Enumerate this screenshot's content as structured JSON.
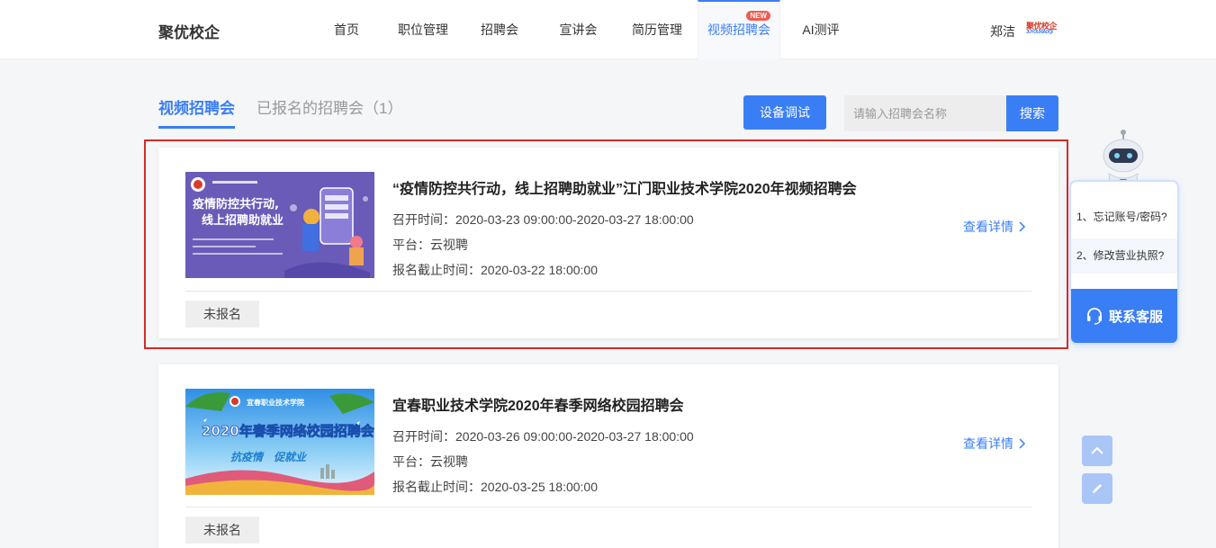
{
  "header": {
    "brand": "聚优校企",
    "nav": [
      {
        "label": "首页"
      },
      {
        "label": "职位管理"
      },
      {
        "label": "招聘会"
      },
      {
        "label": "宣讲会"
      },
      {
        "label": "简历管理"
      },
      {
        "label": "视频招聘会",
        "badge": "NEW",
        "active": true
      },
      {
        "label": "AI测评"
      }
    ],
    "username": "郑洁",
    "logo_text": "聚优校企",
    "logo_sub": "JUYOUXIAOQI"
  },
  "tabs": {
    "video_fairs": "视频招聘会",
    "registered": "已报名的招聘会（1）"
  },
  "toolbar": {
    "device_test": "设备调试",
    "search_placeholder": "请输入招聘会名称",
    "search_label": "搜索"
  },
  "fairs": [
    {
      "title": "“疫情防控共行动，线上招聘助就业”江门职业技术学院2020年视频招聘会",
      "start_time": "召开时间：2020-03-23 09:00:00-2020-03-27 18:00:00",
      "platform": "平台：云视聘",
      "deadline": "报名截止时间：2020-03-22 18:00:00",
      "details": "查看详情",
      "status": "未报名",
      "poster_line1": "疫情防控共行动,",
      "poster_line2": "线上招聘助就业"
    },
    {
      "title": "宜春职业技术学院2020年春季网络校园招聘会",
      "start_time": "召开时间：2020-03-26 09:00:00-2020-03-27 18:00:00",
      "platform": "平台：云视聘",
      "deadline": "报名截止时间：2020-03-25 18:00:00",
      "details": "查看详情",
      "status": "未报名",
      "poster_school": "宜春职业技术学院",
      "poster_title": "2020年春季网络校园招聘会",
      "poster_slogan": "抗疫情　促就业"
    }
  ],
  "help": {
    "q1": "1、忘记账号/密码?",
    "q2": "2、修改营业执照?",
    "contact": "联系客服"
  },
  "colors": {
    "accent": "#3a7ef6",
    "highlight": "#d42a2a",
    "badge": "#f25a4e"
  }
}
